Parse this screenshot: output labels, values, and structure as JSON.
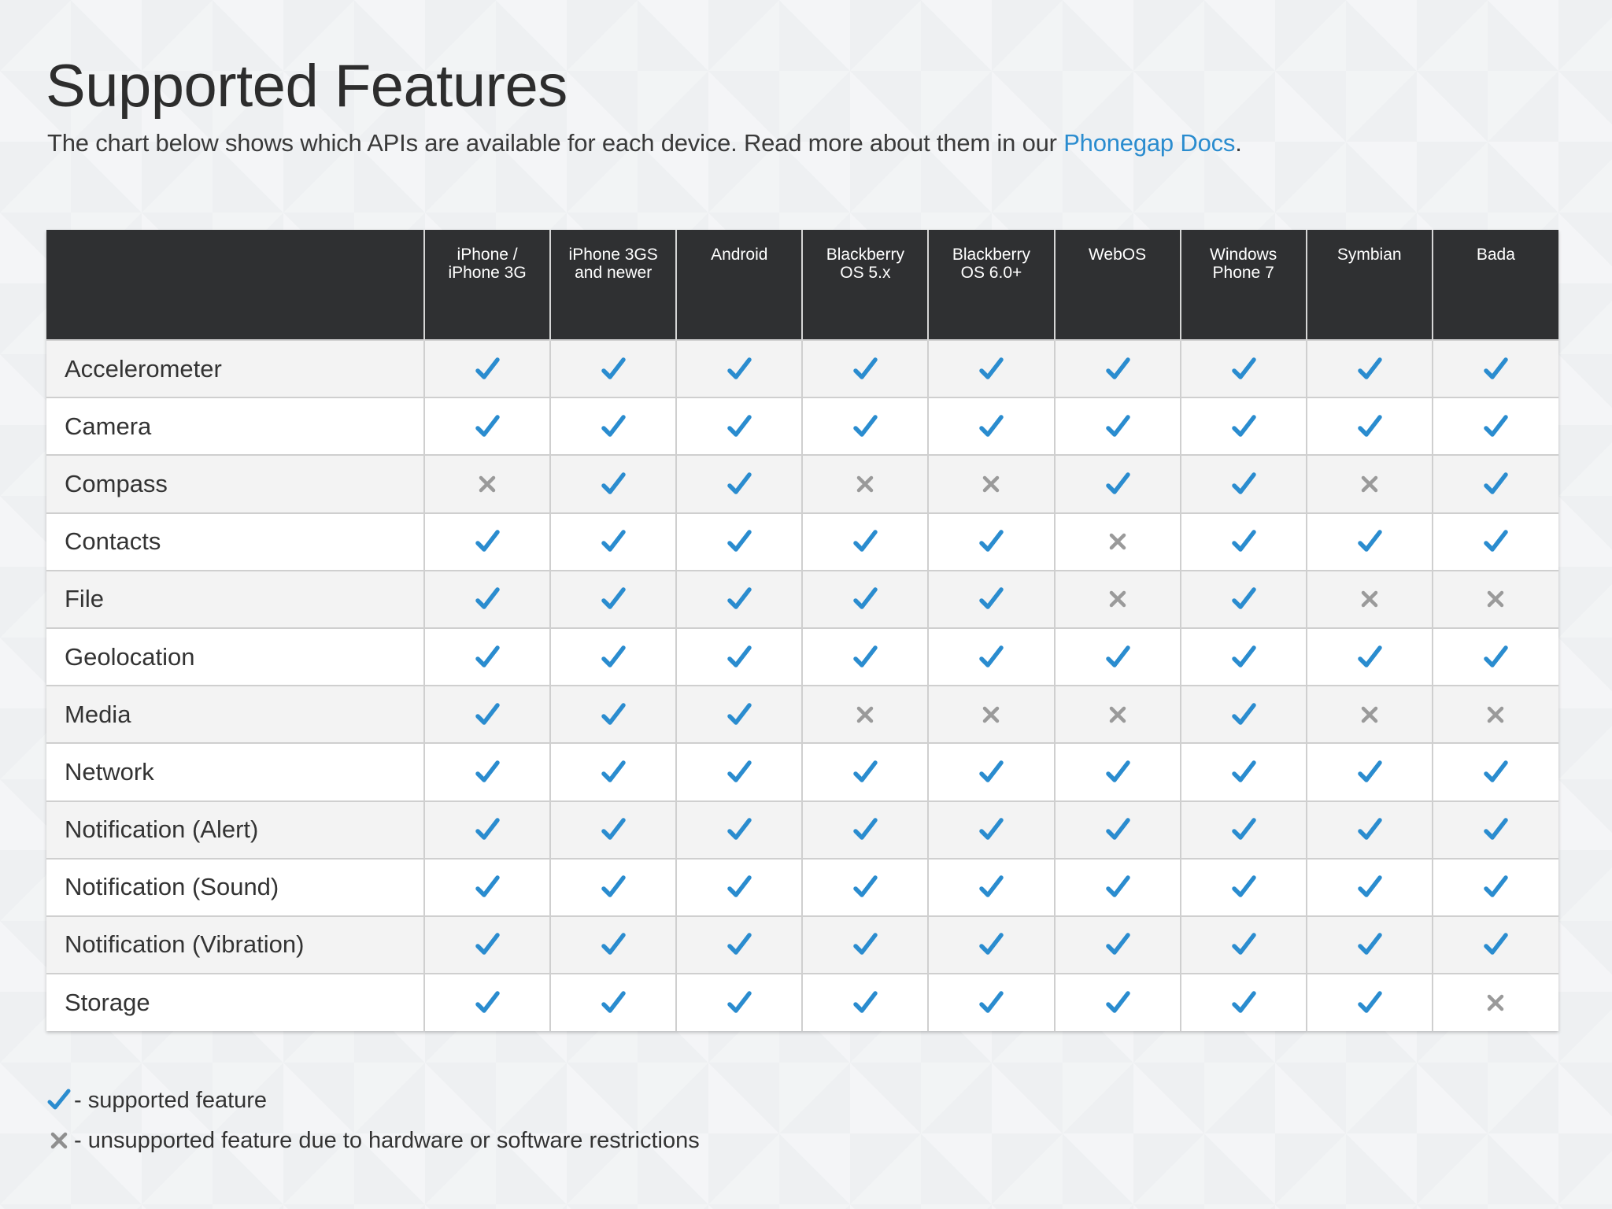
{
  "page": {
    "title": "Supported Features",
    "intro_text": "The chart below shows which APIs are available for each device. Read more about them in our",
    "intro_link": "Phonegap Docs",
    "intro_end": "."
  },
  "colors": {
    "supported": "#2a8ccf",
    "unsupported": "#9a9a9a",
    "header_bg": "#2f3032",
    "link": "#2a8ccf"
  },
  "table": {
    "columns": [
      [
        "iPhone /",
        "iPhone 3G"
      ],
      [
        "iPhone 3GS",
        "and newer"
      ],
      [
        "Android"
      ],
      [
        "Blackberry",
        "OS 5.x"
      ],
      [
        "Blackberry",
        "OS 6.0+"
      ],
      [
        "WebOS"
      ],
      [
        "Windows",
        "Phone 7"
      ],
      [
        "Symbian"
      ],
      [
        "Bada"
      ]
    ],
    "rows": [
      {
        "feature": "Accelerometer",
        "support": [
          1,
          1,
          1,
          1,
          1,
          1,
          1,
          1,
          1
        ]
      },
      {
        "feature": "Camera",
        "support": [
          1,
          1,
          1,
          1,
          1,
          1,
          1,
          1,
          1
        ]
      },
      {
        "feature": "Compass",
        "support": [
          0,
          1,
          1,
          0,
          0,
          1,
          1,
          0,
          1
        ]
      },
      {
        "feature": "Contacts",
        "support": [
          1,
          1,
          1,
          1,
          1,
          0,
          1,
          1,
          1
        ]
      },
      {
        "feature": "File",
        "support": [
          1,
          1,
          1,
          1,
          1,
          0,
          1,
          0,
          0
        ]
      },
      {
        "feature": "Geolocation",
        "support": [
          1,
          1,
          1,
          1,
          1,
          1,
          1,
          1,
          1
        ]
      },
      {
        "feature": "Media",
        "support": [
          1,
          1,
          1,
          0,
          0,
          0,
          1,
          0,
          0
        ]
      },
      {
        "feature": "Network",
        "support": [
          1,
          1,
          1,
          1,
          1,
          1,
          1,
          1,
          1
        ]
      },
      {
        "feature": "Notification (Alert)",
        "support": [
          1,
          1,
          1,
          1,
          1,
          1,
          1,
          1,
          1
        ]
      },
      {
        "feature": "Notification (Sound)",
        "support": [
          1,
          1,
          1,
          1,
          1,
          1,
          1,
          1,
          1
        ]
      },
      {
        "feature": "Notification (Vibration)",
        "support": [
          1,
          1,
          1,
          1,
          1,
          1,
          1,
          1,
          1
        ]
      },
      {
        "feature": "Storage",
        "support": [
          1,
          1,
          1,
          1,
          1,
          1,
          1,
          1,
          0
        ]
      }
    ]
  },
  "legend": {
    "supported": "- supported feature",
    "unsupported": "- unsupported feature due to hardware or software restrictions"
  }
}
